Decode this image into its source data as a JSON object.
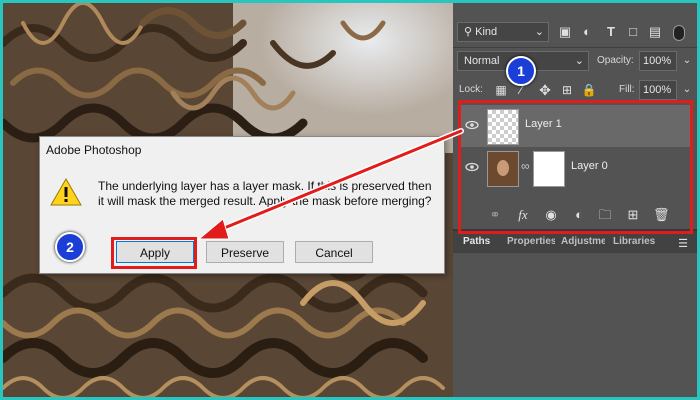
{
  "layers_panel": {
    "filter_kind": "Kind",
    "blend_mode": "Normal",
    "opacity_label": "Opacity:",
    "opacity_value": "100%",
    "lock_label": "Lock:",
    "fill_label": "Fill:",
    "fill_value": "100%",
    "layers": [
      {
        "name": "Layer 1"
      },
      {
        "name": "Layer 0"
      }
    ],
    "tabs": [
      "Paths",
      "Properties",
      "Adjustments",
      "Libraries"
    ]
  },
  "dialog": {
    "title": "Adobe Photoshop",
    "message": "The underlying layer has a layer mask. If this is preserved then it will mask the merged result. Apply the mask before merging?",
    "apply_label": "Apply",
    "preserve_label": "Preserve",
    "cancel_label": "Cancel"
  },
  "annotations": {
    "step1": "1",
    "step2": "2",
    "highlight_color": "#e21b1b",
    "badge_color": "#1b3fd6"
  }
}
